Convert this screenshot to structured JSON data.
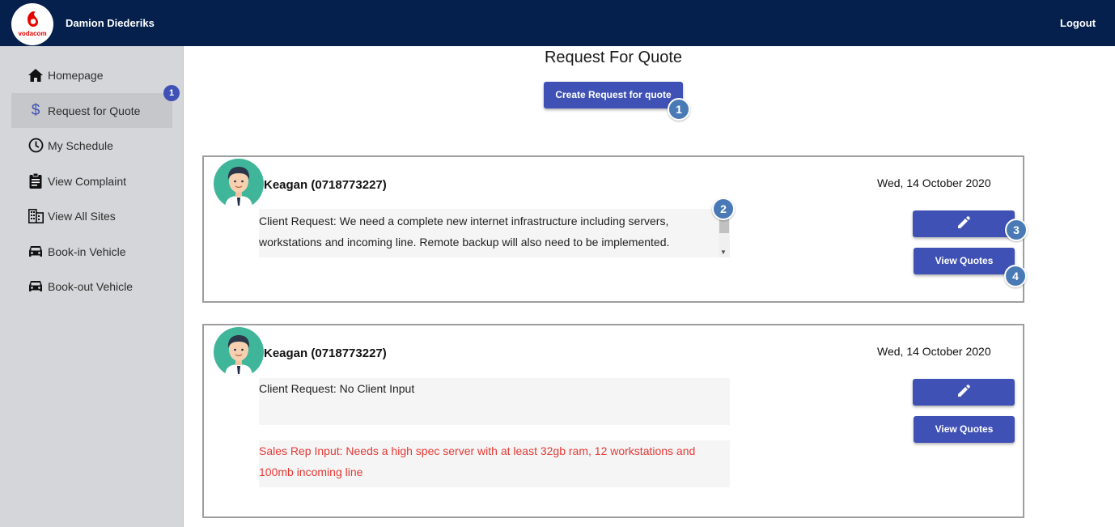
{
  "header": {
    "logo_text": "vodacom",
    "username": "Damion Diederiks",
    "logout_label": "Logout"
  },
  "sidebar": {
    "items": [
      {
        "label": "Homepage",
        "icon": "home-icon"
      },
      {
        "label": "Request for Quote",
        "icon": "dollar-icon",
        "active": true
      },
      {
        "label": "My Schedule",
        "icon": "clock-icon"
      },
      {
        "label": "View Complaint",
        "icon": "clipboard-icon"
      },
      {
        "label": "View All Sites",
        "icon": "building-icon"
      },
      {
        "label": "Book-in Vehicle",
        "icon": "car-icon"
      },
      {
        "label": "Book-out Vehicle",
        "icon": "car-icon"
      }
    ],
    "badge": "1"
  },
  "main": {
    "title": "Request For Quote",
    "create_button": "Create Request for quote"
  },
  "markers": [
    "1",
    "2",
    "3",
    "4"
  ],
  "requests": [
    {
      "client": "Keagan (0718773227)",
      "date": "Wed, 14 October 2020",
      "client_request": "Client Request: We need a complete new internet infrastructure including servers, workstations and incoming line. Remote backup will also need to be implemented.",
      "view_quotes_label": "View Quotes"
    },
    {
      "client": "Keagan (0718773227)",
      "date": "Wed, 14 October 2020",
      "client_request": "Client Request: No Client Input",
      "sales_rep_input": "Sales Rep Input: Needs a high spec server with at least 32gb ram, 12 workstations and 100mb incoming line",
      "view_quotes_label": "View Quotes"
    }
  ],
  "colors": {
    "topbar": "#05204d",
    "accent": "#3f51b5",
    "marker": "#4a7ab5",
    "sales_rep_text": "#e53935",
    "brand_red": "#e60000"
  }
}
